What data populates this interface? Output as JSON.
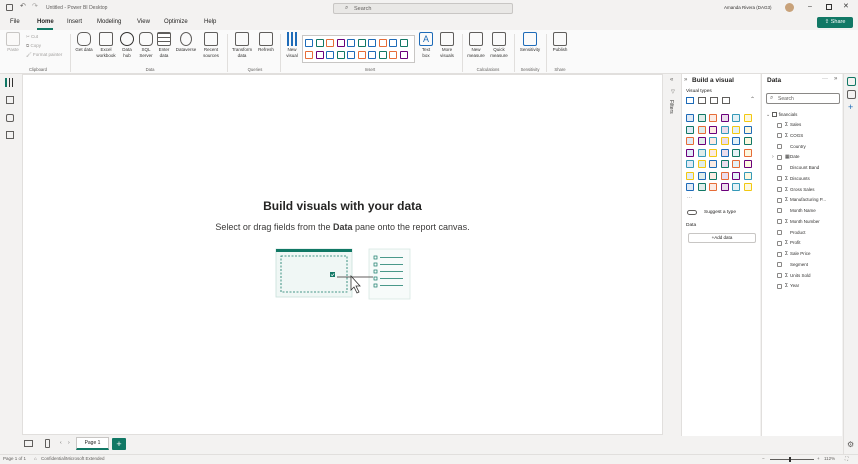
{
  "window": {
    "title": "Untitled - Power BI Desktop",
    "search_placeholder": "Search",
    "user": "Amanda Rivera (DAG3)"
  },
  "menu": {
    "tabs": [
      "File",
      "Home",
      "Insert",
      "Modeling",
      "View",
      "Optimize",
      "Help"
    ],
    "share_label": "Share"
  },
  "ribbon": {
    "clipboard": {
      "paste": "Paste",
      "cut": "Cut",
      "copy": "Copy",
      "format_painter": "Format painter",
      "group": "Clipboard"
    },
    "data": {
      "get_data": "Get data",
      "excel": "Excel workbook",
      "data_hub": "Data hub",
      "sql": "SQL Server",
      "enter": "Enter data",
      "dataverse": "Dataverse",
      "recent": "Recent sources",
      "group": "Data"
    },
    "queries": {
      "transform": "Transform data",
      "refresh": "Refresh",
      "group": "Queries"
    },
    "insert": {
      "new_visual": "New visual",
      "text_box": "Text box",
      "more_visuals": "More visuals",
      "group": "Insert"
    },
    "calculations": {
      "new_measure": "New measure",
      "quick_measure": "Quick measure",
      "group": "Calculations"
    },
    "sensitivity": {
      "label": "Sensitivity",
      "group": "Sensitivity"
    },
    "share": {
      "publish": "Publish",
      "group": "Share"
    }
  },
  "canvas": {
    "title": "Build visuals with your data",
    "subtitle_pre": "Select or drag fields from the ",
    "subtitle_bold": "Data",
    "subtitle_post": " pane onto the report canvas."
  },
  "filters_label": "Filters",
  "viz_pane": {
    "title": "Build a visual",
    "visual_types": "Visual types",
    "suggest": "Suggest a type",
    "data_label": "Data",
    "add_data": "+Add data"
  },
  "data_pane": {
    "title": "Data",
    "search_placeholder": "Search",
    "table": "financials",
    "fields": [
      {
        "name": "Sales",
        "sigma": true
      },
      {
        "name": "COGS",
        "sigma": true
      },
      {
        "name": "Country",
        "sigma": false
      },
      {
        "name": "Date",
        "sigma": false,
        "expand": true
      },
      {
        "name": "Discount Band",
        "sigma": false
      },
      {
        "name": "Discounts",
        "sigma": true
      },
      {
        "name": "Gross Sales",
        "sigma": true
      },
      {
        "name": "Manufacturing P...",
        "sigma": true
      },
      {
        "name": "Month Name",
        "sigma": false
      },
      {
        "name": "Month Number",
        "sigma": true
      },
      {
        "name": "Product",
        "sigma": false
      },
      {
        "name": "Profit",
        "sigma": true
      },
      {
        "name": "Sale Price",
        "sigma": true
      },
      {
        "name": "Segment",
        "sigma": false
      },
      {
        "name": "Units Sold",
        "sigma": true
      },
      {
        "name": "Year",
        "sigma": true
      }
    ]
  },
  "pages": {
    "tab": "Page 1",
    "add": "+"
  },
  "status": {
    "page": "Page 1 of 1",
    "label": "Confidential\\Microsoft Extended",
    "zoom": "112%"
  },
  "colors": {
    "accent": "#117865",
    "brand_yellow": "#f2c811"
  }
}
